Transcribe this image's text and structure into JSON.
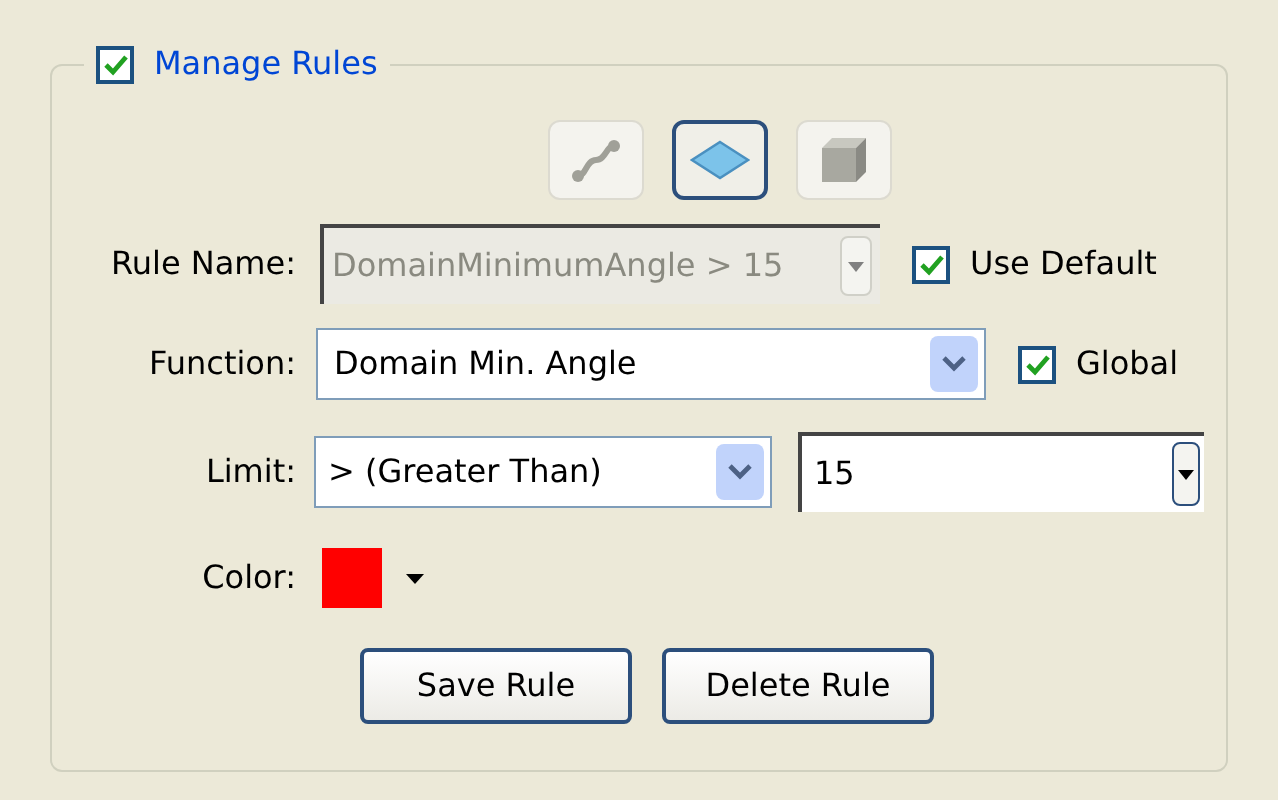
{
  "group": {
    "title": "Manage Rules",
    "checked": true
  },
  "mode_buttons": [
    {
      "kind": "edge",
      "selected": false
    },
    {
      "kind": "face",
      "selected": true
    },
    {
      "kind": "volume",
      "selected": false
    }
  ],
  "rule_name": {
    "label": "Rule Name:",
    "value": "DomainMinimumAngle > 15",
    "disabled": true
  },
  "use_default": {
    "label": "Use Default",
    "checked": true
  },
  "function": {
    "label": "Function:",
    "value": "Domain Min. Angle"
  },
  "global": {
    "label": "Global",
    "checked": true
  },
  "limit": {
    "label": "Limit:",
    "operator": "> (Greater Than)",
    "value": "15"
  },
  "color": {
    "label": "Color:",
    "color": "#ff0000"
  },
  "buttons": [
    {
      "label": "Save Rule"
    },
    {
      "label": "Delete Rule"
    }
  ]
}
